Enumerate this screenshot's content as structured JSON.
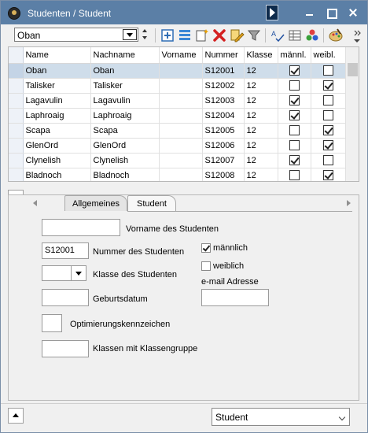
{
  "window": {
    "title": "Studenten / Student"
  },
  "toolbar": {
    "record_selector_value": "Oban",
    "tools": [
      "new-record-icon",
      "list-icon",
      "new-document-icon",
      "delete-icon",
      "edit-icon",
      "filter-icon",
      "sort-icon",
      "grid-settings-icon",
      "colors-icon",
      "palette-icon",
      "more-icon"
    ]
  },
  "grid": {
    "columns": [
      "Name",
      "Nachname",
      "Vorname",
      "Nummer",
      "Klasse",
      "männl.",
      "weibl."
    ],
    "rows": [
      {
        "name": "Oban",
        "nachname": "Oban",
        "vorname": "",
        "nummer": "S12001",
        "klasse": "12",
        "maennl": true,
        "weibl": false,
        "selected": true
      },
      {
        "name": "Talisker",
        "nachname": "Talisker",
        "vorname": "",
        "nummer": "S12002",
        "klasse": "12",
        "maennl": false,
        "weibl": true
      },
      {
        "name": "Lagavulin",
        "nachname": "Lagavulin",
        "vorname": "",
        "nummer": "S12003",
        "klasse": "12",
        "maennl": true,
        "weibl": false
      },
      {
        "name": "Laphroaig",
        "nachname": "Laphroaig",
        "vorname": "",
        "nummer": "S12004",
        "klasse": "12",
        "maennl": true,
        "weibl": false
      },
      {
        "name": "Scapa",
        "nachname": "Scapa",
        "vorname": "",
        "nummer": "S12005",
        "klasse": "12",
        "maennl": false,
        "weibl": true
      },
      {
        "name": "GlenOrd",
        "nachname": "GlenOrd",
        "vorname": "",
        "nummer": "S12006",
        "klasse": "12",
        "maennl": false,
        "weibl": true
      },
      {
        "name": "Clynelish",
        "nachname": "Clynelish",
        "vorname": "",
        "nummer": "S12007",
        "klasse": "12",
        "maennl": true,
        "weibl": false
      },
      {
        "name": "Bladnoch",
        "nachname": "Bladnoch",
        "vorname": "",
        "nummer": "S12008",
        "klasse": "12",
        "maennl": false,
        "weibl": true
      }
    ]
  },
  "tabs": {
    "general": "Allgemeines",
    "student": "Student"
  },
  "form": {
    "vorname_value": "",
    "vorname_label": "Vorname des Studenten",
    "nummer_value": "S12001",
    "nummer_label": "Nummer des Studenten",
    "klasse_value": "",
    "klasse_label": "Klasse des Studenten",
    "geburtsdatum_value": "",
    "geburtsdatum_label": "Geburtsdatum",
    "optimierung_value": "",
    "optimierung_label": "Optimierungskennzeichen",
    "klassengruppe_value": "",
    "klassengruppe_label": "Klassen mit Klassengruppe",
    "maennlich_label": "männlich",
    "maennlich_checked": true,
    "weiblich_label": "weiblich",
    "weiblich_checked": false,
    "email_label": "e-mail Adresse",
    "email_value": ""
  },
  "footer": {
    "view_selector_value": "Student"
  },
  "colors": {
    "titlebar": "#5b7fa6",
    "selected_row": "#cfddea",
    "delete_red": "#d42020"
  }
}
